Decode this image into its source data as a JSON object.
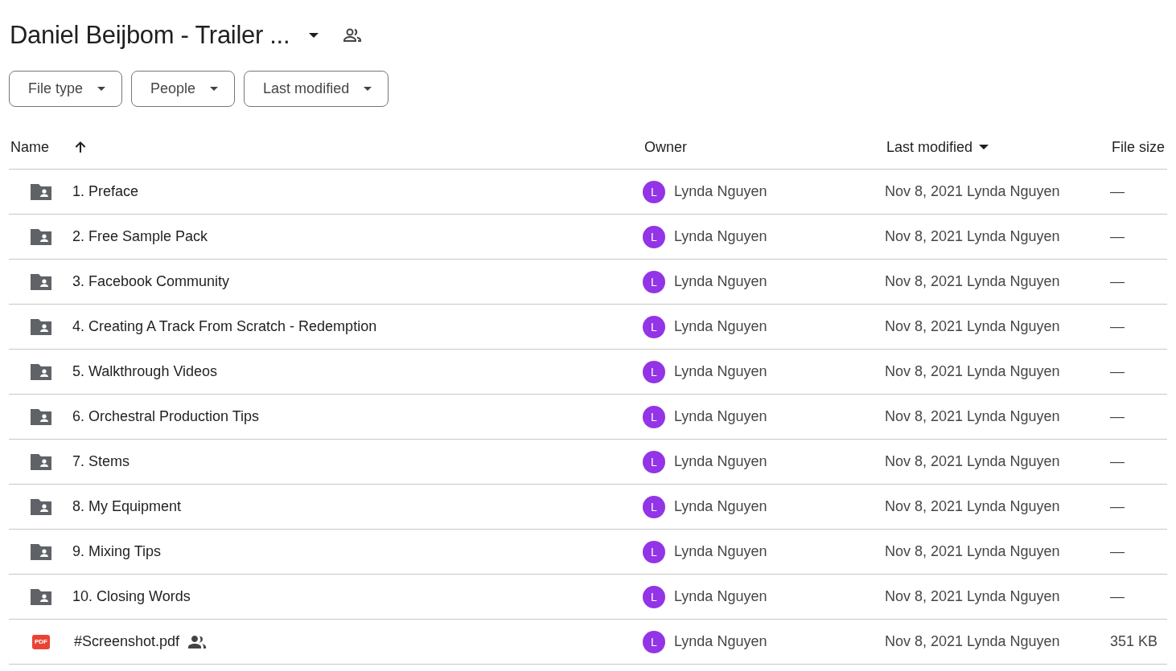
{
  "title": "Daniel Beijbom - Trailer ...",
  "filters": [
    "File type",
    "People",
    "Last modified"
  ],
  "columns": [
    {
      "label": "Name",
      "sorted": true,
      "descending": false
    },
    {
      "label": "Owner",
      "sorted": false
    },
    {
      "label": "Last modified",
      "sorted": true,
      "descending": true
    },
    {
      "label": "File size",
      "sorted": false
    }
  ],
  "rows": [
    {
      "kind": "folder",
      "name": "1. Preface",
      "shared": false,
      "avatar": "L",
      "color": "#9334e6",
      "owner": "Lynda Nguyen",
      "modified": "Nov 8, 2021",
      "modified_by": "Lynda Nguyen",
      "size": "—"
    },
    {
      "kind": "folder",
      "name": "2. Free Sample Pack",
      "shared": false,
      "avatar": "L",
      "color": "#9334e6",
      "owner": "Lynda Nguyen",
      "modified": "Nov 8, 2021",
      "modified_by": "Lynda Nguyen",
      "size": "—"
    },
    {
      "kind": "folder",
      "name": "3. Facebook Community",
      "shared": false,
      "avatar": "L",
      "color": "#9334e6",
      "owner": "Lynda Nguyen",
      "modified": "Nov 8, 2021",
      "modified_by": "Lynda Nguyen",
      "size": "—"
    },
    {
      "kind": "folder",
      "name": "4. Creating A Track From Scratch - Redemption",
      "shared": false,
      "avatar": "L",
      "color": "#9334e6",
      "owner": "Lynda Nguyen",
      "modified": "Nov 8, 2021",
      "modified_by": "Lynda Nguyen",
      "size": "—"
    },
    {
      "kind": "folder",
      "name": "5. Walkthrough Videos",
      "shared": false,
      "avatar": "L",
      "color": "#9334e6",
      "owner": "Lynda Nguyen",
      "modified": "Nov 8, 2021",
      "modified_by": "Lynda Nguyen",
      "size": "—"
    },
    {
      "kind": "folder",
      "name": "6. Orchestral Production Tips",
      "shared": false,
      "avatar": "L",
      "color": "#9334e6",
      "owner": "Lynda Nguyen",
      "modified": "Nov 8, 2021",
      "modified_by": "Lynda Nguyen",
      "size": "—"
    },
    {
      "kind": "folder",
      "name": "7. Stems",
      "shared": false,
      "avatar": "L",
      "color": "#9334e6",
      "owner": "Lynda Nguyen",
      "modified": "Nov 8, 2021",
      "modified_by": "Lynda Nguyen",
      "size": "—"
    },
    {
      "kind": "folder",
      "name": "8. My Equipment",
      "shared": false,
      "avatar": "L",
      "color": "#9334e6",
      "owner": "Lynda Nguyen",
      "modified": "Nov 8, 2021",
      "modified_by": "Lynda Nguyen",
      "size": "—"
    },
    {
      "kind": "folder",
      "name": "9. Mixing Tips",
      "shared": false,
      "avatar": "L",
      "color": "#9334e6",
      "owner": "Lynda Nguyen",
      "modified": "Nov 8, 2021",
      "modified_by": "Lynda Nguyen",
      "size": "—"
    },
    {
      "kind": "folder",
      "name": "10. Closing Words",
      "shared": false,
      "avatar": "L",
      "color": "#9334e6",
      "owner": "Lynda Nguyen",
      "modified": "Nov 8, 2021",
      "modified_by": "Lynda Nguyen",
      "size": "—"
    },
    {
      "kind": "pdf",
      "icon_label": "PDF",
      "name": "#Screenshot.pdf",
      "shared": true,
      "avatar": "L",
      "color": "#9334e6",
      "owner": "Lynda Nguyen",
      "modified": "Nov 8, 2021",
      "modified_by": "Lynda Nguyen",
      "size": "351 KB"
    }
  ]
}
